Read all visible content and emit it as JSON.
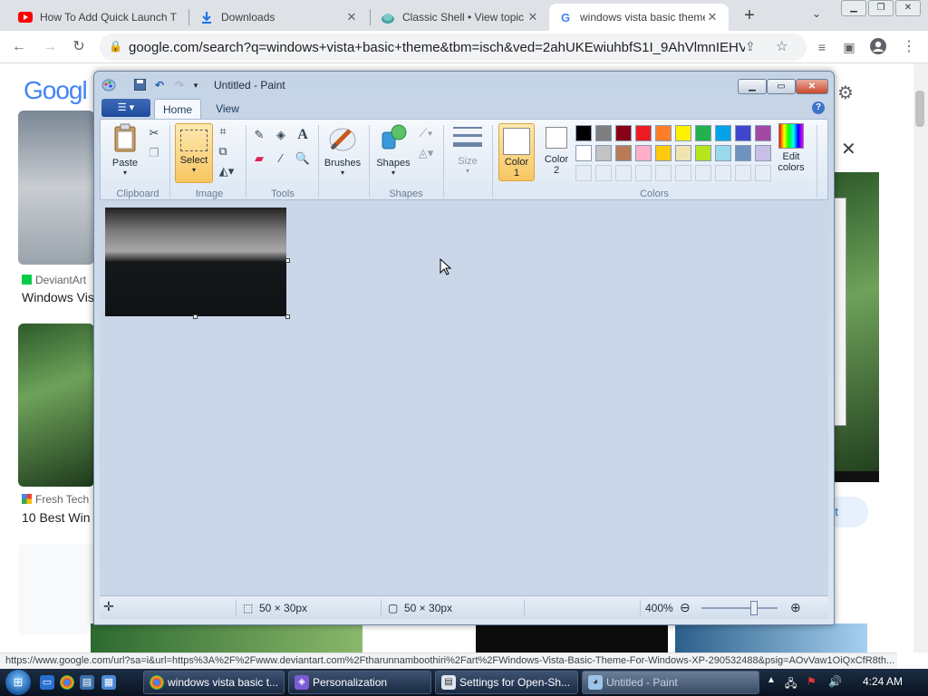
{
  "browser": {
    "tabs": [
      {
        "title": "How To Add Quick Launch T",
        "favicon": "youtube-icon",
        "favcolor": "#ff0000"
      },
      {
        "title": "Downloads",
        "favicon": "download-icon",
        "favcolor": "#1a73e8"
      },
      {
        "title": "Classic Shell • View topic -",
        "favicon": "shell-icon",
        "favcolor": "#4aa3a3"
      },
      {
        "title": "windows vista basic theme",
        "favicon": "google-g-icon",
        "favcolor": "#4285f4"
      }
    ],
    "url": "google.com/search?q=windows+vista+basic+theme&tbm=isch&ved=2ahUKEwiuhbfS1I_9AhVlmnIEHVC9B..."
  },
  "google": {
    "logo": "Googl",
    "results": [
      {
        "source": "DeviantArt",
        "title": "Windows Vis"
      },
      {
        "source": "Fresh Tech",
        "title": "10 Best Win"
      }
    ],
    "visit_label": "sit"
  },
  "paint": {
    "title": "Untitled - Paint",
    "tabs": {
      "home": "Home",
      "view": "View"
    },
    "groups": {
      "clipboard": "Clipboard",
      "image": "Image",
      "tools": "Tools",
      "shapes": "Shapes",
      "colors": "Colors"
    },
    "buttons": {
      "paste": "Paste",
      "select": "Select",
      "brushes": "Brushes",
      "shapes": "Shapes",
      "size": "Size",
      "color1_line1": "Color",
      "color1_line2": "1",
      "color2_line1": "Color",
      "color2_line2": "2",
      "edit_colors_line1": "Edit",
      "edit_colors_line2": "colors"
    },
    "palette_row1": [
      "#000000",
      "#7f7f7f",
      "#880015",
      "#ed1c24",
      "#ff7f27",
      "#fff200",
      "#22b14c",
      "#00a2e8",
      "#3f48cc",
      "#a349a4"
    ],
    "palette_row2": [
      "#ffffff",
      "#c3c3c3",
      "#b97a57",
      "#ffaec9",
      "#ffc90e",
      "#efe4b0",
      "#b5e61d",
      "#99d9ea",
      "#7092be",
      "#c8bfe7"
    ],
    "status": {
      "selection_size": "50 × 30px",
      "image_size": "50 × 30px",
      "zoom": "400%"
    }
  },
  "status_link": "https://www.google.com/url?sa=i&url=https%3A%2F%2Fwww.deviantart.com%2Ftharunnamboothiri%2Fart%2FWindows-Vista-Basic-Theme-For-Windows-XP-290532488&psig=AOvVaw1OiQxCfR8th...",
  "taskbar": {
    "items": [
      {
        "label": "windows vista basic t...",
        "icon": "chrome-icon"
      },
      {
        "label": "Personalization",
        "icon": "personalization-icon"
      },
      {
        "label": "Settings for Open-Sh...",
        "icon": "settings-icon"
      },
      {
        "label": "Untitled - Paint",
        "icon": "paint-icon"
      }
    ],
    "clock": "4:24 AM"
  }
}
